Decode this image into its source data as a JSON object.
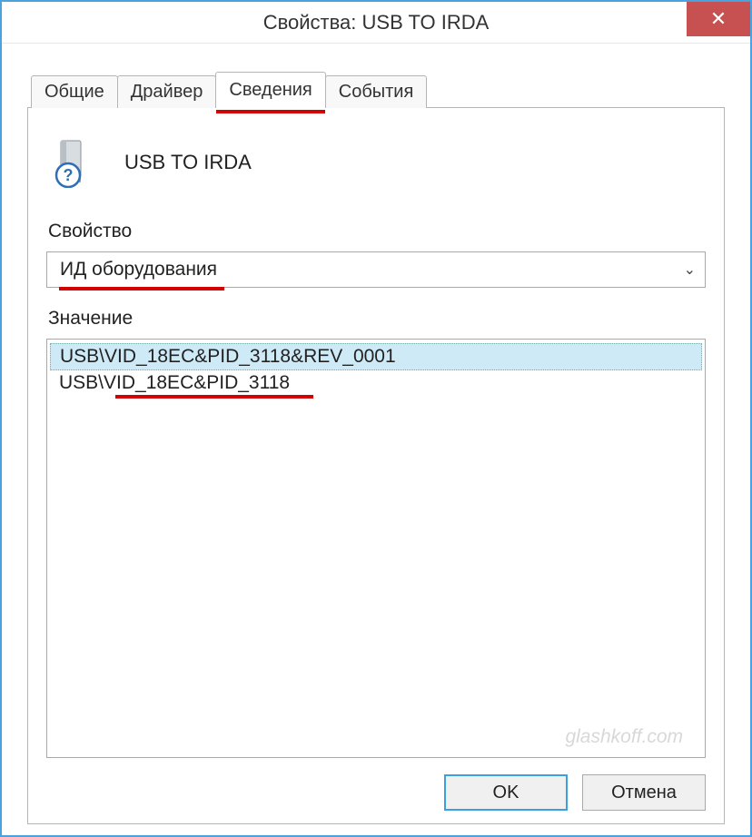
{
  "window": {
    "title": "Свойства: USB TO IRDA"
  },
  "tabs": {
    "items": [
      {
        "label": "Общие"
      },
      {
        "label": "Драйвер"
      },
      {
        "label": "Сведения"
      },
      {
        "label": "События"
      }
    ],
    "active_index": 2
  },
  "device": {
    "name": "USB TO IRDA"
  },
  "property": {
    "label": "Свойство",
    "selected": "ИД оборудования"
  },
  "value": {
    "label": "Значение",
    "items": [
      "USB\\VID_18EC&PID_3118&REV_0001",
      "USB\\VID_18EC&PID_3118"
    ],
    "selected_index": 0
  },
  "buttons": {
    "ok": "OK",
    "cancel": "Отмена"
  },
  "watermark": "glashkoff.com"
}
